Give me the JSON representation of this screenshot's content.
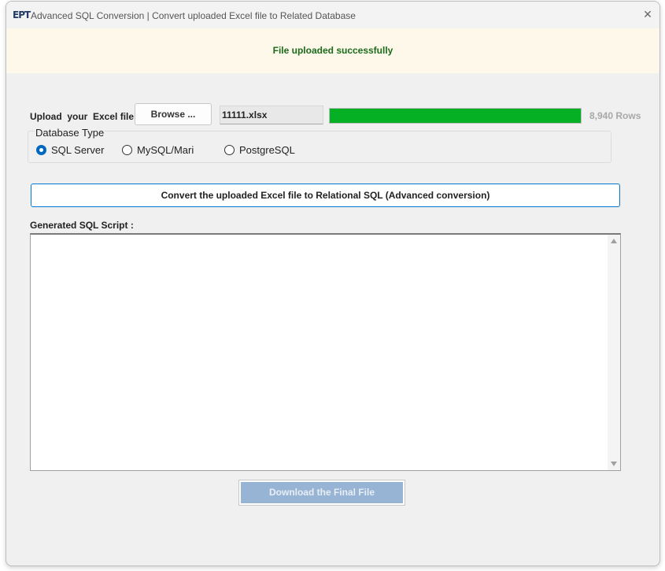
{
  "window": {
    "app_icon_text": "EPT",
    "title": "Advanced SQL Conversion | Convert uploaded Excel file to Related Database",
    "close_glyph": "✕"
  },
  "banner": {
    "message": "File uploaded successfully",
    "background": "#fdf8ea",
    "text_color": "#1a6b1a"
  },
  "upload": {
    "label": "Upload  your  Excel file :",
    "browse_label": "Browse ...",
    "file_name": "11111.xlsx",
    "progress_percent": 100,
    "progress_color": "#06b025",
    "rows_label": "8,940 Rows"
  },
  "database_type": {
    "legend": "Database Type",
    "options": [
      {
        "label": "SQL Server",
        "checked": true
      },
      {
        "label": "MySQL/Mari",
        "checked": false
      },
      {
        "label": "PostgreSQL",
        "checked": false
      }
    ]
  },
  "convert_button_label": "Convert the uploaded Excel file to Relational SQL (Advanced conversion)",
  "script": {
    "label": "Generated SQL Script :",
    "value": ""
  },
  "download_button_label": "Download the Final File",
  "colors": {
    "accent": "#0078d4",
    "radio_checked": "#0067c0",
    "download_disabled": "#98b4d4"
  }
}
